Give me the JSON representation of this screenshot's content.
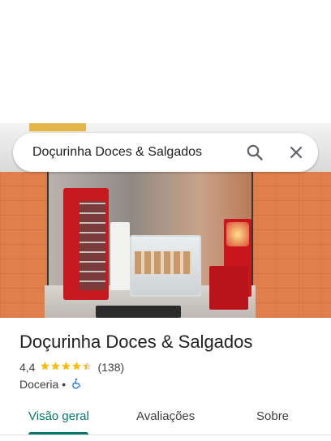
{
  "search": {
    "query": "Doçurinha Doces & Salgados",
    "search_icon": "search-icon",
    "close_icon": "close-icon"
  },
  "photo": {
    "subject": "storefront-photo"
  },
  "place": {
    "name": "Doçurinha Doces & Salgados",
    "rating": "4,4",
    "rating_stars": 4.4,
    "review_count": "(138)",
    "category": "Doceria",
    "separator": "•",
    "accessibility_icon": "wheelchair-icon"
  },
  "tabs": [
    {
      "label": "Visão geral",
      "active": true
    },
    {
      "label": "Avaliações",
      "active": false
    },
    {
      "label": "Sobre",
      "active": false
    }
  ],
  "colors": {
    "accent": "#00796b",
    "star": "#fbbc04",
    "wheelchair": "#1a73e8",
    "text": "#202124"
  }
}
